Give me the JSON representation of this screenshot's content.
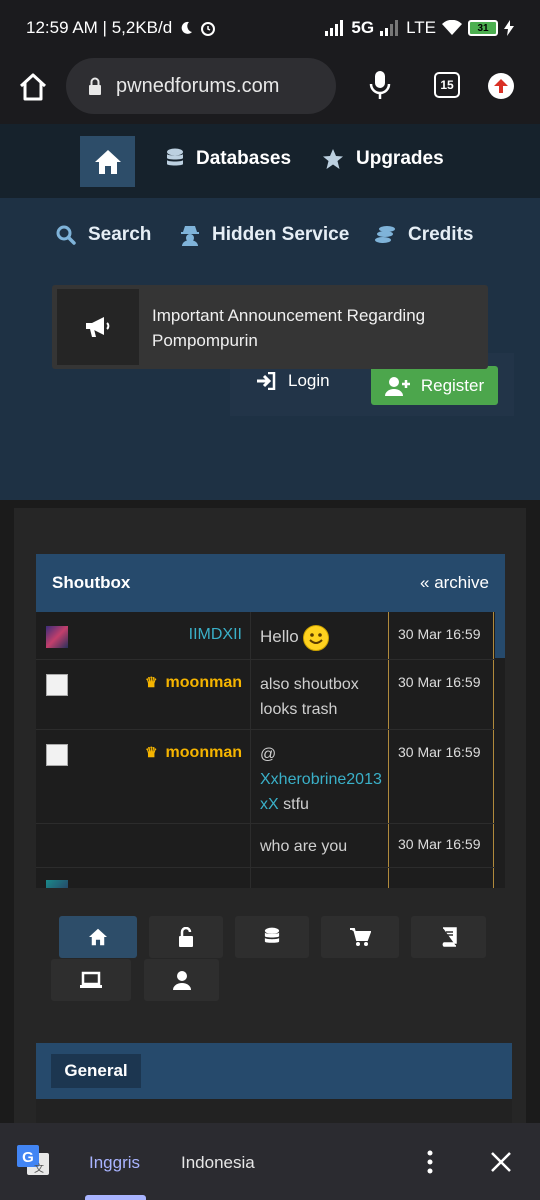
{
  "status_bar": {
    "time_speed": "12:59 AM | 5,2KB/d",
    "network": "5G",
    "network2": "LTE",
    "battery": "31"
  },
  "browser": {
    "url": "pwnedforums.com",
    "tab_count": "15"
  },
  "nav_top": {
    "databases": "Databases",
    "upgrades": "Upgrades"
  },
  "nav_secondary": {
    "search": "Search",
    "hidden_service": "Hidden Service",
    "credits": "Credits"
  },
  "announcement": {
    "text": "Important Announcement Regarding Pompompurin"
  },
  "auth": {
    "login": "Login",
    "register": "Register"
  },
  "shoutbox": {
    "title": "Shoutbox",
    "archive": "« archive",
    "rows": [
      {
        "user": "IIMDXII",
        "msg": "Hello",
        "time": "30 Mar 16:59"
      },
      {
        "user": "moonman",
        "msg": "also shoutbox looks trash",
        "time": "30 Mar 16:59"
      },
      {
        "user": "moonman",
        "msg_prefix": "@",
        "msg_link": "Xxherobrine2013xX",
        "msg_suffix": " stfu",
        "time": "30 Mar 16:59"
      },
      {
        "user": "",
        "msg": "who are you",
        "time": "30 Mar 16:59"
      }
    ],
    "crown": "♛"
  },
  "sections": {
    "general": "General"
  },
  "translate_bar": {
    "active_lang": "Inggris",
    "other_lang": "Indonesia"
  },
  "colors": {
    "accent_blue": "#264a6c",
    "username_cyan": "#3ab0c8",
    "username_gold": "#f5b400",
    "register_green": "#4ca64c"
  }
}
